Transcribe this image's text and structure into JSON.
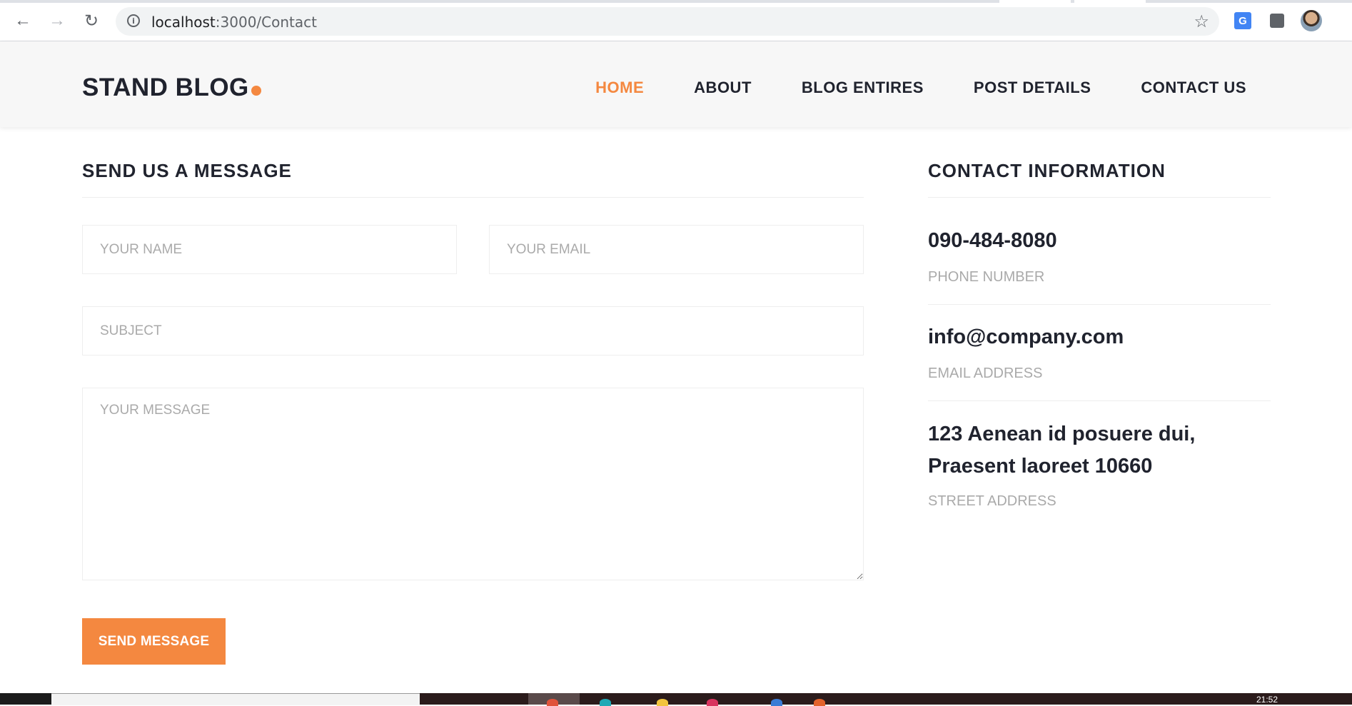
{
  "browser": {
    "url_host": "localhost",
    "url_path": ":3000/Contact"
  },
  "site": {
    "logo": "STAND BLOG",
    "nav": [
      {
        "label": "HOME",
        "active": true
      },
      {
        "label": "ABOUT",
        "active": false
      },
      {
        "label": "BLOG ENTIRES",
        "active": false
      },
      {
        "label": "POST DETAILS",
        "active": false
      },
      {
        "label": "CONTACT US",
        "active": false
      }
    ]
  },
  "form": {
    "heading": "SEND US A MESSAGE",
    "name_placeholder": "YOUR NAME",
    "email_placeholder": "YOUR EMAIL",
    "subject_placeholder": "SUBJECT",
    "message_placeholder": "YOUR MESSAGE",
    "submit_label": "SEND MESSAGE"
  },
  "contact": {
    "heading": "CONTACT INFORMATION",
    "phone": "090-484-8080",
    "phone_label": "PHONE NUMBER",
    "email": "info@company.com",
    "email_label": "EMAIL ADDRESS",
    "address_line1": "123 Aenean id posuere dui,",
    "address_line2": "Praesent laoreet 10660",
    "address_label": "STREET ADDRESS"
  },
  "taskbar": {
    "clock": "21:52"
  },
  "colors": {
    "accent": "#f48840",
    "text_dark": "#20232e",
    "placeholder": "#aaaaaa"
  }
}
